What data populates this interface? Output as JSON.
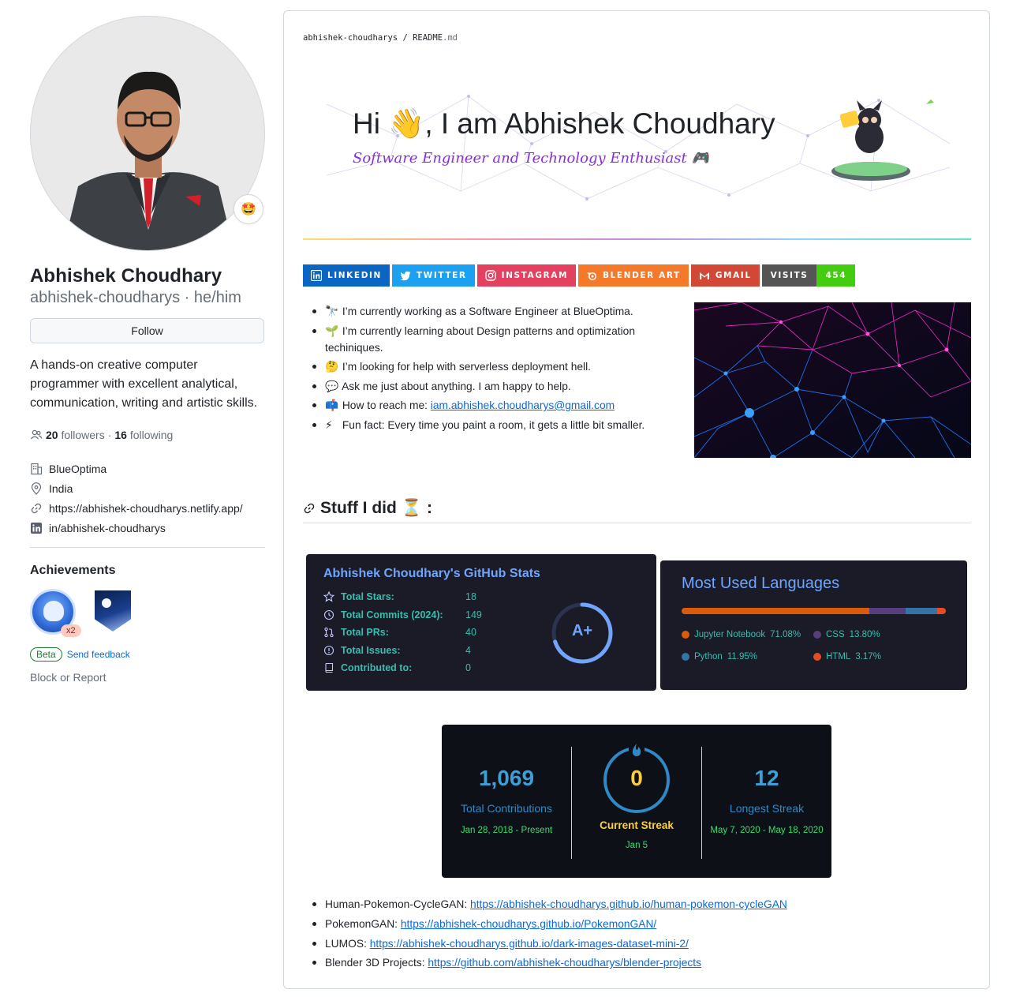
{
  "profile": {
    "name": "Abhishek Choudhary",
    "login": "abhishek-choudharys",
    "pronouns": "he/him",
    "login_line": "abhishek-choudharys · he/him",
    "status_emoji": "🤩",
    "follow_label": "Follow",
    "bio": "A hands-on creative computer programmer with excellent analytical, communication, writing and artistic skills.",
    "followers_count": "20",
    "followers_label": "followers",
    "separator": "·",
    "following_count": "16",
    "following_label": "following",
    "details": {
      "company": "BlueOptima",
      "location": "India",
      "website": "https://abhishek-choudharys.netlify.app/",
      "linkedin": "in/abhishek-choudharys"
    },
    "achievements_title": "Achievements",
    "achievement_multiplier": "x2",
    "beta_label": "Beta",
    "feedback_label": "Send feedback",
    "block_label": "Block or Report"
  },
  "readme": {
    "breadcrumb_user": "abhishek-choudharys",
    "breadcrumb_sep": "/",
    "breadcrumb_file": "README",
    "breadcrumb_ext": ".md",
    "banner": {
      "greeting_start": "Hi",
      "wave_emoji": "👋",
      "greeting_end": ", I am Abhishek Choudhary",
      "subtitle": "Software Engineer and Technology Enthusiast",
      "subtitle_emoji": "🎮"
    },
    "shields": [
      {
        "label": "LINKEDIN",
        "color": "#0a66c2"
      },
      {
        "label": "TWITTER",
        "color": "#1ca0f2"
      },
      {
        "label": "INSTAGRAM",
        "color": "#e4405f"
      },
      {
        "label": "BLENDER ART",
        "color": "#f5792a"
      },
      {
        "label": "GMAIL",
        "color": "#d14836"
      }
    ],
    "visits_label": "VISITS",
    "visits_count": "454",
    "about": [
      {
        "emoji": "🔭",
        "text": "I’m currently working as a Software Engineer at BlueOptima."
      },
      {
        "emoji": "🌱",
        "text": "I’m currently learning about Design patterns and optimization techiniques."
      },
      {
        "emoji": "🤔",
        "text": "I’m looking for help with serverless deployment hell."
      },
      {
        "emoji": "💬",
        "text": "Ask me just about anything. I am happy to help."
      },
      {
        "emoji": "📫",
        "text": "How to reach me: ",
        "link": "iam.abhishek.choudharys@gmail.com"
      },
      {
        "emoji": "⚡",
        "text": "Fun fact: Every time you paint a room, it gets a little bit smaller."
      }
    ],
    "stuff_heading": "Stuff I did",
    "stuff_emoji": "⏳",
    "stuff_suffix": ":",
    "stats": {
      "title": "Abhishek Choudhary's GitHub Stats",
      "rows": [
        {
          "label": "Total Stars:",
          "value": "18"
        },
        {
          "label": "Total Commits (2024):",
          "value": "149"
        },
        {
          "label": "Total PRs:",
          "value": "40"
        },
        {
          "label": "Total Issues:",
          "value": "4"
        },
        {
          "label": "Contributed to:",
          "value": "0"
        }
      ],
      "rank": "A+",
      "rank_ring_fraction": 0.7
    },
    "languages": {
      "title": "Most Used Languages",
      "items": [
        {
          "name": "Jupyter Notebook",
          "percent": "71.08%",
          "value": 71.08,
          "color": "#da5b0b"
        },
        {
          "name": "CSS",
          "percent": "13.80%",
          "value": 13.8,
          "color": "#563d7c"
        },
        {
          "name": "Python",
          "percent": "11.95%",
          "value": 11.95,
          "color": "#3572a5"
        },
        {
          "name": "HTML",
          "percent": "3.17%",
          "value": 3.17,
          "color": "#e34c26"
        }
      ]
    },
    "streak": {
      "total_value": "1,069",
      "total_label": "Total Contributions",
      "total_range": "Jan 28, 2018 - Present",
      "current_value": "0",
      "current_label": "Current Streak",
      "current_date": "Jan 5",
      "longest_value": "12",
      "longest_label": "Longest Streak",
      "longest_range": "May 7, 2020 - May 18, 2020"
    },
    "projects": [
      {
        "name": "Human-Pokemon-CycleGAN: ",
        "url": "https://abhishek-choudharys.github.io/human-pokemon-cycleGAN"
      },
      {
        "name": "PokemonGAN: ",
        "url": "https://abhishek-choudharys.github.io/PokemonGAN/"
      },
      {
        "name": "LUMOS: ",
        "url": "https://abhishek-choudharys.github.io/dark-images-dataset-mini-2/"
      },
      {
        "name": "Blender 3D Projects: ",
        "url": "https://github.com/abhishek-choudharys/blender-projects"
      }
    ]
  }
}
